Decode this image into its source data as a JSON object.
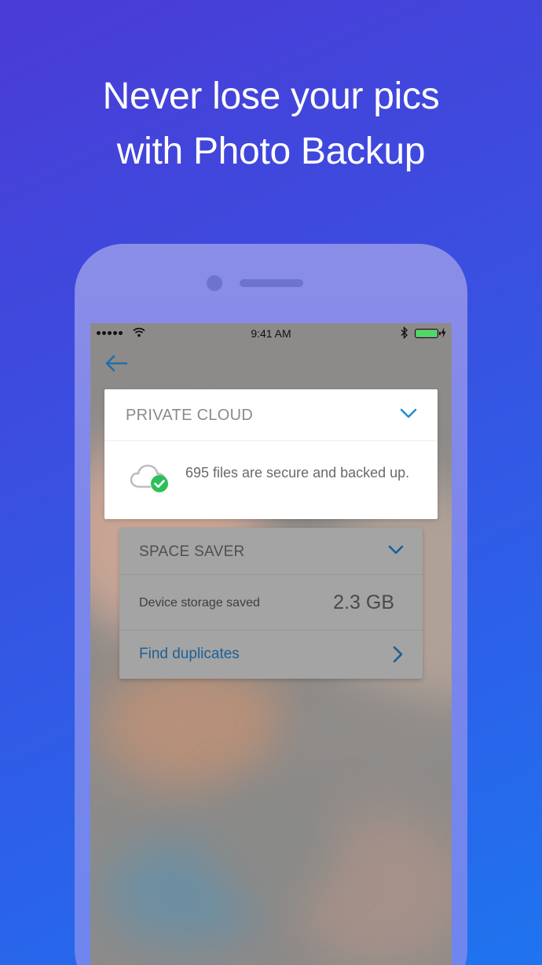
{
  "headline": {
    "line1": "Never lose your pics",
    "line2": "with Photo Backup"
  },
  "status_bar": {
    "time": "9:41 AM",
    "battery_level": 1.0,
    "icons": [
      "signal-dots-icon",
      "wifi-icon",
      "bluetooth-icon",
      "battery-icon",
      "charging-bolt-icon"
    ]
  },
  "nav": {
    "back_icon": "arrow-left-icon"
  },
  "private_cloud": {
    "title": "PRIVATE CLOUD",
    "status_text": "695 files are secure and backed up.",
    "icon": "cloud-check-icon"
  },
  "space_saver": {
    "title": "SPACE SAVER",
    "storage_label": "Device storage saved",
    "storage_value": "2.3 GB",
    "find_duplicates_label": "Find duplicates"
  },
  "colors": {
    "accent": "#1f8fd6",
    "check_green": "#2fbf5a",
    "battery_green": "#4cd964"
  }
}
